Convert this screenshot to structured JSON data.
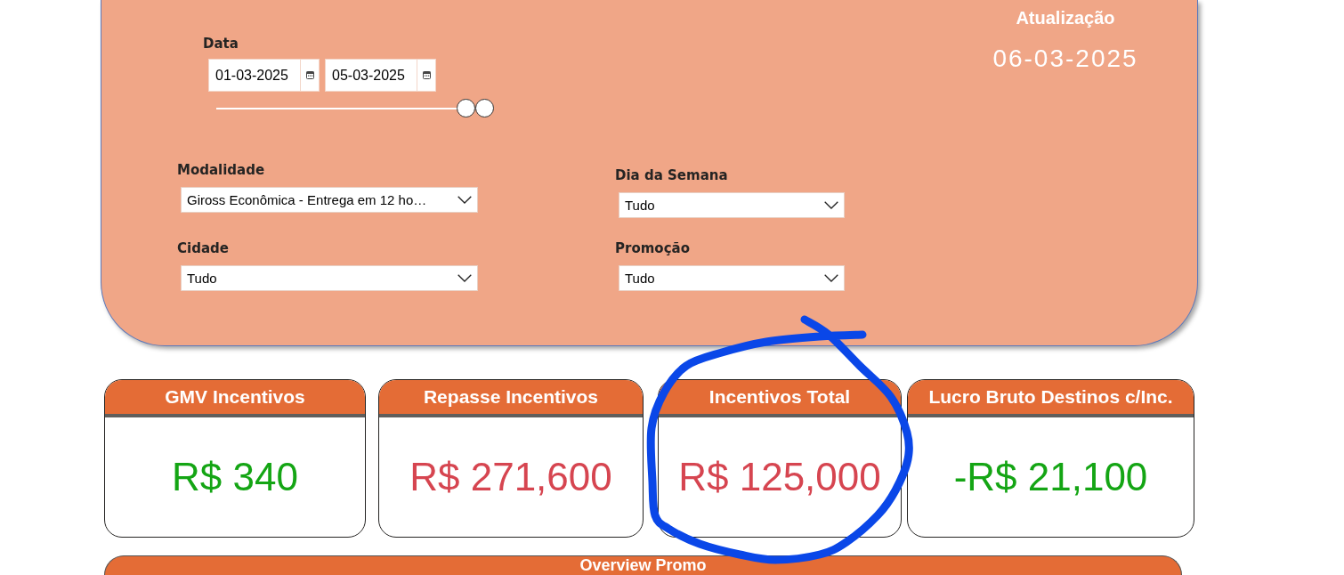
{
  "update": {
    "label": "Atualização",
    "date": "06-03-2025"
  },
  "filters": {
    "date": {
      "label": "Data",
      "start": "01-03-2025",
      "end": "05-03-2025",
      "slider": {
        "thumbs": [
          {
            "level": 0.93
          },
          {
            "level": 1.0
          }
        ]
      }
    },
    "dropdowns": [
      {
        "label": "Modalidade",
        "value": "Giross Econômica - Entrega em 12 ho…"
      },
      {
        "label": "Dia da Semana",
        "value": "Tudo"
      },
      {
        "label": "Cidade",
        "value": "Tudo"
      },
      {
        "label": "Promoção",
        "value": "Tudo"
      }
    ]
  },
  "cards": [
    {
      "title": "GMV Incentivos",
      "value": "R$ 340",
      "color": "#14a514",
      "circled": false
    },
    {
      "title": "Repasse Incentivos",
      "value": "R$ 271,600",
      "color": "#d64550",
      "circled": false
    },
    {
      "title": "Incentivos Total",
      "value": "R$ 125,000",
      "color": "#d64550",
      "circled": true
    },
    {
      "title": "Lucro Bruto Destinos c/Inc.",
      "value": "-R$ 21,100",
      "color": "#14a514",
      "circled": false
    }
  ],
  "section_bar": {
    "title": "Overview Promo"
  }
}
